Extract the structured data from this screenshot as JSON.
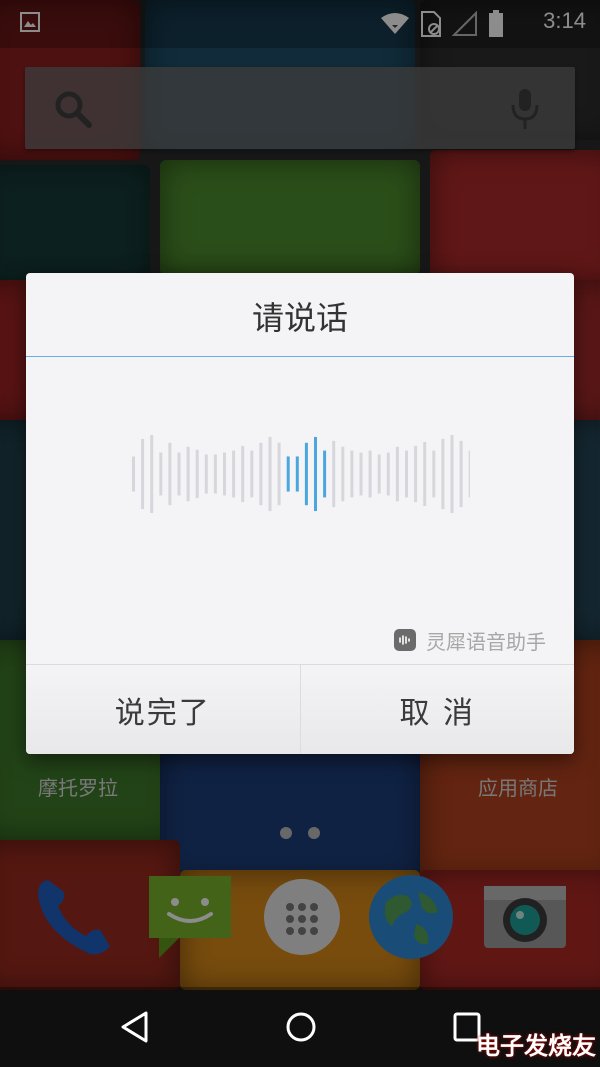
{
  "status_bar": {
    "time": "3:14",
    "icons": [
      "image-notification-icon",
      "wifi-icon",
      "sim-card-icon",
      "no-signal-icon",
      "battery-icon"
    ]
  },
  "search_bar": {
    "icons": [
      "search-icon",
      "mic-icon"
    ]
  },
  "dialog": {
    "title": "请说话",
    "brand_label": "灵犀语音助手",
    "buttons": {
      "done": "说完了",
      "cancel": "取 消"
    }
  },
  "home_screen": {
    "app_labels": {
      "left": "摩托罗拉",
      "right": "应用商店"
    },
    "page_count": 2,
    "dock": [
      "phone-icon",
      "messaging-icon",
      "app-drawer-icon",
      "browser-icon",
      "camera-icon"
    ]
  },
  "nav_bar": {
    "buttons": [
      "back",
      "home",
      "recents"
    ]
  },
  "watermark": "电子发烧友",
  "colors": {
    "accent_blue": "#4aa6dd",
    "divider_blue": "#68aee0"
  }
}
